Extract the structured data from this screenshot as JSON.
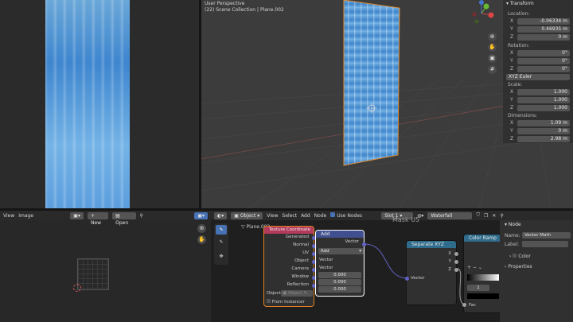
{
  "viewport": {
    "title": "User Perspective",
    "subtitle": "(22) Scene Collection | Plane.002",
    "axis_x": "X",
    "axis_y": "Y",
    "axis_z": "Z"
  },
  "npanel": {
    "transform": "Transform",
    "location": "Location:",
    "loc": [
      {
        "k": "X",
        "v": "-0.06334 m"
      },
      {
        "k": "Y",
        "v": "0.46935 m"
      },
      {
        "k": "Z",
        "v": "0 m"
      }
    ],
    "rotation": "Rotation:",
    "rot": [
      {
        "k": "X",
        "v": "0°"
      },
      {
        "k": "Y",
        "v": "0°"
      },
      {
        "k": "Z",
        "v": "0°"
      }
    ],
    "euler": "XYZ Euler",
    "scale": "Scale:",
    "scl": [
      {
        "k": "X",
        "v": "1.000"
      },
      {
        "k": "Y",
        "v": "1.000"
      },
      {
        "k": "Z",
        "v": "1.000"
      }
    ],
    "dimensions": "Dimensions:",
    "dim": [
      {
        "k": "X",
        "v": "1.09 m"
      },
      {
        "k": "Y",
        "v": "0 m"
      },
      {
        "k": "Z",
        "v": "2.98 m"
      }
    ]
  },
  "uv_header": {
    "view": "View",
    "image": "Image",
    "new": "New",
    "open": "Open"
  },
  "node_header": {
    "object": "Object",
    "view": "View",
    "select": "Select",
    "add": "Add",
    "node": "Node",
    "use_nodes": "Use Nodes",
    "slot": "Slot 1",
    "material": "Waterfall"
  },
  "breadcrumb": {
    "object": "Plane.002",
    "material": "Waterfall"
  },
  "frame_label": "Mask U5",
  "tex_coord": {
    "title": "Texture Coordinate",
    "outputs": [
      "Generated",
      "Normal",
      "UV",
      "Object",
      "Camera",
      "Window",
      "Reflection"
    ],
    "object_label": "Object:",
    "object_placeholder": "Object",
    "from_instancer": "From Instancer"
  },
  "vector_math": {
    "title": "Add",
    "out": "Vector",
    "op": "Add",
    "in1": "Vector",
    "in2": "Vector",
    "vals": [
      "0.000",
      "0.000",
      "0.000"
    ]
  },
  "separate": {
    "title": "Separate XYZ",
    "outs": [
      "X",
      "Y",
      "Z"
    ],
    "in": "Vector"
  },
  "ramp": {
    "title": "Color Ramp",
    "pos": "1",
    "fac": "Fac"
  },
  "side": {
    "node": "Node",
    "name_lbl": "Name:",
    "name_val": "Vector Math",
    "label_lbl": "Label:",
    "color": "Color",
    "properties": "Properties"
  },
  "colors": {
    "accent": "#4772b3",
    "selected_orange": "#e07f1f",
    "tex_hdr": "#b33a5b",
    "math_hdr": "#3f4f8f",
    "sep_hdr": "#2f6b8a",
    "ramp_hdr": "#2f6b8a"
  }
}
